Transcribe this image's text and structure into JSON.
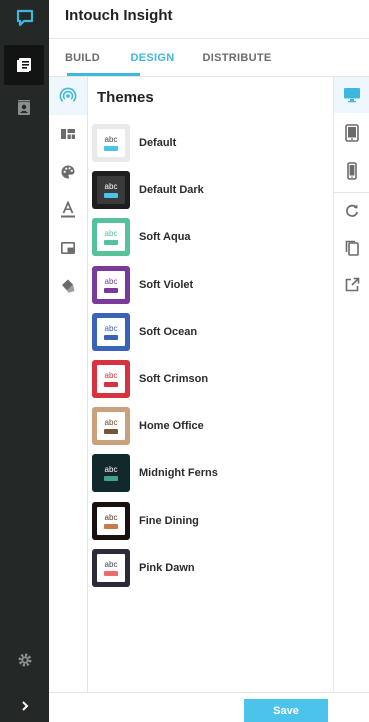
{
  "app": {
    "title": "Intouch Insight"
  },
  "tabs": [
    {
      "label": "BUILD"
    },
    {
      "label": "DESIGN"
    },
    {
      "label": "DISTRIBUTE"
    }
  ],
  "themes_panel": {
    "title": "Themes",
    "items": [
      {
        "name": "Default",
        "abc": "abc",
        "frame": "#e9e9e9",
        "inner": "#ffffff",
        "text_color": "#444444",
        "bar": "#4cc3ea"
      },
      {
        "name": "Default Dark",
        "abc": "abc",
        "frame": "#1e1e1e",
        "inner": "#3a3a3a",
        "text_color": "#ffffff",
        "bar": "#4cc3ea"
      },
      {
        "name": "Soft Aqua",
        "abc": "abc",
        "frame": "#55c29c",
        "inner": "#ffffff",
        "text_color": "#55c29c",
        "bar": "#55c29c"
      },
      {
        "name": "Soft Violet",
        "abc": "abc",
        "frame": "#7a3a9a",
        "inner": "#ffffff",
        "text_color": "#7a3a9a",
        "bar": "#7a3a9a"
      },
      {
        "name": "Soft Ocean",
        "abc": "abc",
        "frame": "#3a63b8",
        "inner": "#ffffff",
        "text_color": "#3a63b8",
        "bar": "#3a63b8"
      },
      {
        "name": "Soft Crimson",
        "abc": "abc",
        "frame": "#d8323f",
        "inner": "#ffffff",
        "text_color": "#d8323f",
        "bar": "#d8323f"
      },
      {
        "name": "Home Office",
        "abc": "abc",
        "frame": "#c9a27c",
        "inner": "#ffffff",
        "text_color": "#6b4a2e",
        "bar": "#7a5234"
      },
      {
        "name": "Midnight Ferns",
        "abc": "abc",
        "frame": "#0f2a2c",
        "inner": "#13282a",
        "text_color": "#ffffff",
        "bar": "#3fa58a"
      },
      {
        "name": "Fine Dining",
        "abc": "abc",
        "frame": "#1a1010",
        "inner": "#ffffff",
        "text_color": "#5a3a2a",
        "bar": "#c77a4a"
      },
      {
        "name": "Pink Dawn",
        "abc": "abc",
        "frame": "#2a2a3a",
        "inner": "#ffffff",
        "text_color": "#444444",
        "bar": "#ef6a6a"
      }
    ]
  },
  "tool_rail": {
    "items": [
      {
        "icon": "broadcast-icon",
        "active": true
      },
      {
        "icon": "layout-icon"
      },
      {
        "icon": "palette-icon"
      },
      {
        "icon": "text-color-icon"
      },
      {
        "icon": "window-icon"
      },
      {
        "icon": "paint-bucket-icon"
      }
    ]
  },
  "preview_rail": {
    "items": [
      {
        "icon": "desktop-icon",
        "active": true
      },
      {
        "icon": "tablet-icon"
      },
      {
        "icon": "phone-icon"
      },
      {
        "icon": "refresh-icon"
      },
      {
        "icon": "copy-icon"
      },
      {
        "icon": "external-link-icon"
      }
    ]
  },
  "footer": {
    "save_label": "Save"
  },
  "colors": {
    "accent": "#3fb8de",
    "rail_bg": "#242826",
    "save_bg": "#4cc3ea"
  }
}
